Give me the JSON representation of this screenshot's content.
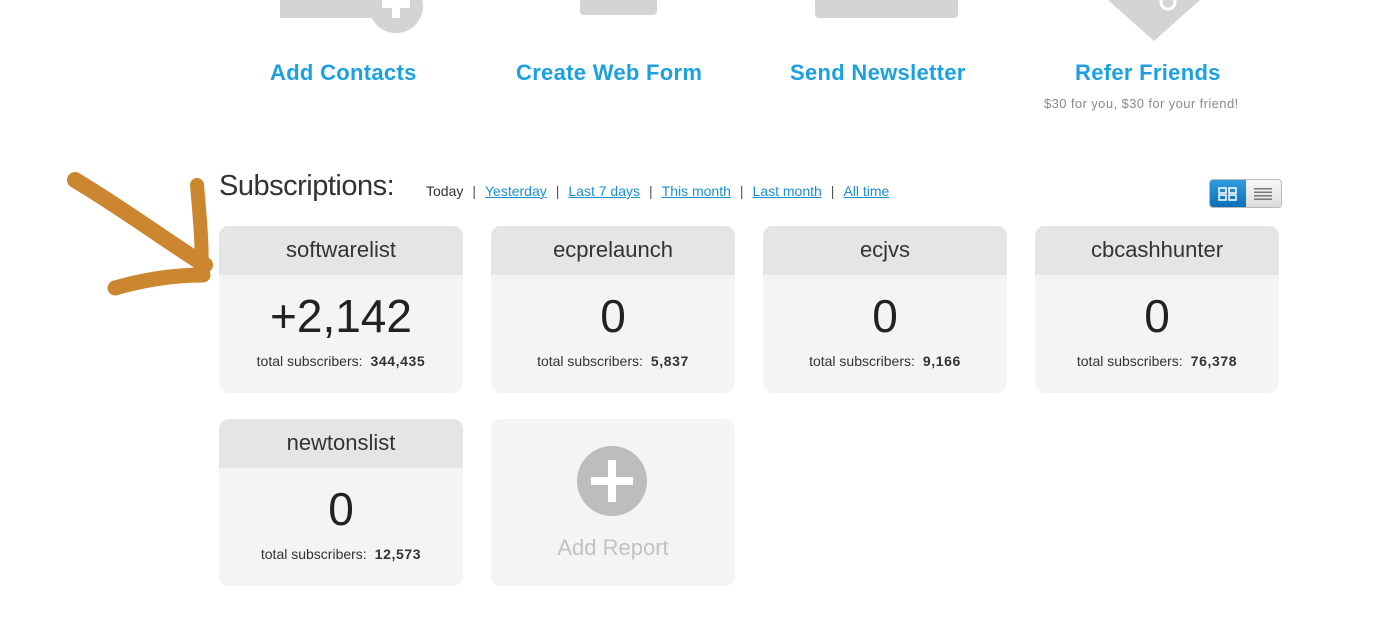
{
  "quick_actions": [
    {
      "title": "Add Contacts",
      "icon": "add-contact-icon"
    },
    {
      "title": "Create Web Form",
      "icon": "web-form-icon"
    },
    {
      "title": "Send Newsletter",
      "icon": "newsletter-icon"
    },
    {
      "title": "Refer Friends",
      "icon": "tag-icon",
      "subtitle": "$30 for you, $30 for your friend!"
    }
  ],
  "subscriptions": {
    "title": "Subscriptions:",
    "filters": [
      "Today",
      "Yesterday",
      "Last 7 days",
      "This month",
      "Last month",
      "All time"
    ],
    "active_filter": "Today",
    "view_modes": [
      "grid-view-icon",
      "list-view-icon"
    ]
  },
  "cards": [
    {
      "name": "softwarelist",
      "change": "+2,142",
      "total_label": "total subscribers:",
      "total": "344,435"
    },
    {
      "name": "ecprelaunch",
      "change": "0",
      "total_label": "total subscribers:",
      "total": "5,837"
    },
    {
      "name": "ecjvs",
      "change": "0",
      "total_label": "total subscribers:",
      "total": "9,166"
    },
    {
      "name": "cbcashhunter",
      "change": "0",
      "total_label": "total subscribers:",
      "total": "76,378"
    },
    {
      "name": "newtonslist",
      "change": "0",
      "total_label": "total subscribers:",
      "total": "12,573"
    }
  ],
  "add_report": {
    "label": "Add Report",
    "icon": "plus-circle-icon"
  },
  "annotation": {
    "icon": "arrow-annotation",
    "color": "#cc8630"
  },
  "colors": {
    "link": "#1ba0e1",
    "accent": "#1a8fd0",
    "card_bg": "#f4f4f4",
    "card_head": "#e5e5e5"
  }
}
